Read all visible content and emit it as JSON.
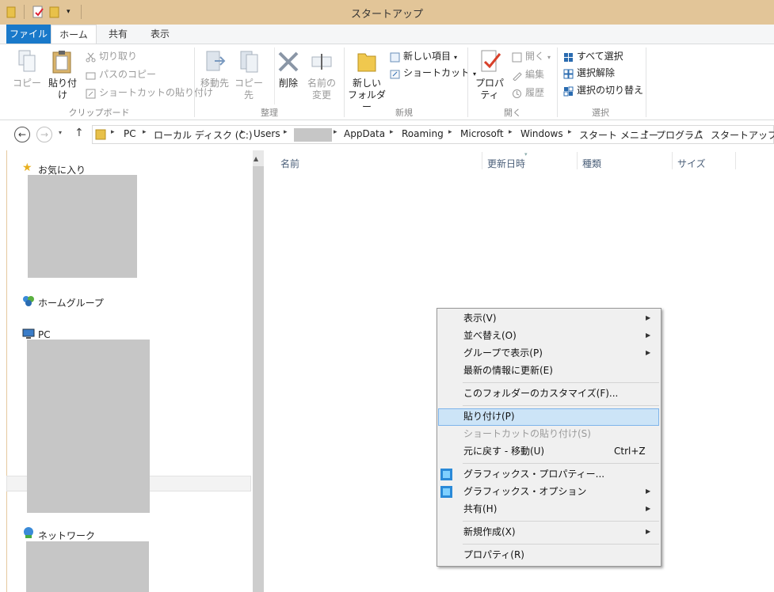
{
  "window": {
    "title": "スタートアップ"
  },
  "ribbon_tabs": [
    {
      "label": "ファイル"
    },
    {
      "label": "ホーム"
    },
    {
      "label": "共有"
    },
    {
      "label": "表示"
    }
  ],
  "ribbon": {
    "clipboard": {
      "copy": "コピー",
      "paste": "貼り付け",
      "cut": "切り取り",
      "copy_path": "パスのコピー",
      "paste_shortcut": "ショートカットの貼り付け",
      "group_label": "クリップボード"
    },
    "organize": {
      "move_to": "移動先",
      "copy_to": "コピー先",
      "delete": "削除",
      "rename_1": "名前の",
      "rename_2": "変更",
      "group_label": "整理"
    },
    "new": {
      "new_folder_1": "新しい",
      "new_folder_2": "フォルダー",
      "new_item": "新しい項目",
      "shortcut": "ショートカット",
      "group_label": "新規"
    },
    "open": {
      "properties": "プロパティ",
      "open": "開く",
      "edit": "編集",
      "history": "履歴",
      "group_label": "開く"
    },
    "select": {
      "select_all": "すべて選択",
      "select_none": "選択解除",
      "invert": "選択の切り替え",
      "group_label": "選択"
    }
  },
  "address": {
    "crumbs": [
      "PC",
      "ローカル ディスク (C:)",
      "Users",
      "AppData",
      "Roaming",
      "Microsoft",
      "Windows",
      "スタート メニュー",
      "プログラム",
      "スタートアップ"
    ]
  },
  "nav": {
    "favorites": "お気に入り",
    "homegroup": "ホームグループ",
    "pc": "PC",
    "network": "ネットワーク"
  },
  "columns": [
    "名前",
    "更新日時",
    "種類",
    "サイズ"
  ],
  "context_menu": {
    "items": [
      {
        "label": "表示(V)",
        "submenu": true
      },
      {
        "label": "並べ替え(O)",
        "submenu": true
      },
      {
        "label": "グループで表示(P)",
        "submenu": true
      },
      {
        "label": "最新の情報に更新(E)"
      },
      {
        "label": "このフォルダーのカスタマイズ(F)..."
      },
      {
        "label": "貼り付け(P)",
        "highlighted": true
      },
      {
        "label": "ショートカットの貼り付け(S)",
        "disabled": true
      },
      {
        "label": "元に戻す - 移動(U)",
        "shortcut": "Ctrl+Z"
      },
      {
        "label": "グラフィックス・プロパティー..."
      },
      {
        "label": "グラフィックス・オプション",
        "submenu": true
      },
      {
        "label": "共有(H)",
        "submenu": true
      },
      {
        "label": "新規作成(X)",
        "submenu": true
      },
      {
        "label": "プロパティ(R)"
      }
    ]
  },
  "colors": {
    "title_bar": "#e2c598",
    "file_tab": "#1979ca",
    "menu_highlight": "#cce4f7",
    "redacted": "#c6c6c6"
  }
}
